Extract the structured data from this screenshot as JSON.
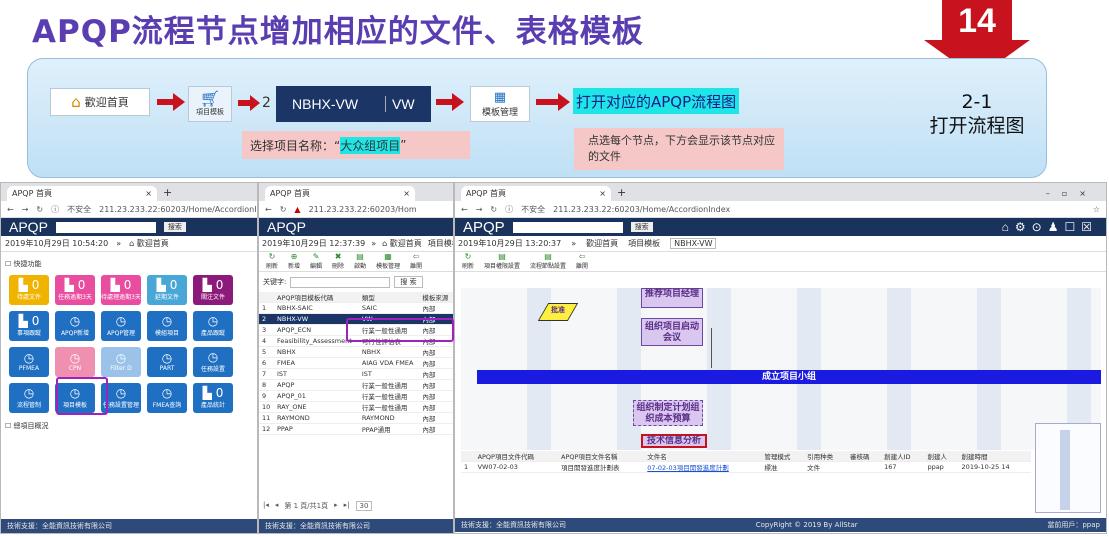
{
  "title": "APQP流程节点增加相应的文件、表格模板",
  "badge_number": "14",
  "banner": {
    "home_label": "歡迎首頁",
    "project_template_label": "項目模板",
    "row_num": "2",
    "row_code": "NBHX-VW",
    "row_type": "VW",
    "template_mgmt_label": "模板管理",
    "open_flow_text": "打开对应的APQP流程图",
    "select_text_prefix": "选择项目名称：“",
    "select_text_highlight": "大众组项目",
    "select_text_suffix": "”",
    "node_hint": "点选每个节点，下方会显示该节点对应的文件",
    "step_number": "2-1",
    "step_text": "打开流程图"
  },
  "win1": {
    "tab_title": "APQP 首頁",
    "url_prefix": "不安全",
    "url": "211.23.233.22:60203/Home/AccordionInd",
    "logo": "APQP",
    "search_btn": "搜索",
    "datetime": "2019年10月29日 10:54:20",
    "home_tab": "歡迎首頁",
    "section_quick": "快捷功能",
    "section_overview": "總項目概況",
    "tiles": [
      {
        "label": "待處文件",
        "count": "0",
        "color": "#f0b400"
      },
      {
        "label": "任務逾期3天",
        "count": "0",
        "color": "#e94da0"
      },
      {
        "label": "待處理逾期3天",
        "count": "0",
        "color": "#e94da0"
      },
      {
        "label": "延期文件",
        "count": "0",
        "color": "#49a7d8"
      },
      {
        "label": "關注文件",
        "count": "0",
        "color": "#8c1a7a"
      },
      {
        "label": "事項跟蹤",
        "count": "0",
        "color": "#1f6fc2"
      },
      {
        "label": "APQP新增",
        "count": "",
        "color": "#1f6fc2"
      },
      {
        "label": "APQP管理",
        "count": "",
        "color": "#1f6fc2"
      },
      {
        "label": "模組項目",
        "count": "",
        "color": "#1f6fc2"
      },
      {
        "label": "產品跟蹤",
        "count": "",
        "color": "#1f6fc2"
      },
      {
        "label": "PFMEA",
        "count": "",
        "color": "#1f6fc2"
      },
      {
        "label": "CPN",
        "count": "",
        "color": "#f090b0"
      },
      {
        "label": "Filter D",
        "count": "",
        "color": "#9bc3ea"
      },
      {
        "label": "PART",
        "count": "",
        "color": "#1f6fc2"
      },
      {
        "label": "任務設置",
        "count": "",
        "color": "#1f6fc2"
      },
      {
        "label": "流程管制",
        "count": "",
        "color": "#1f6fc2"
      },
      {
        "label": "項目模板",
        "count": "",
        "color": "#1f6fc2"
      },
      {
        "label": "任務設置管理",
        "count": "",
        "color": "#1f6fc2"
      },
      {
        "label": "FMEA查詢",
        "count": "",
        "color": "#1f6fc2"
      },
      {
        "label": "產品統計",
        "count": "0",
        "color": "#1f6fc2"
      }
    ],
    "footer": "技術支援：全能資訊技術有限公司"
  },
  "win2": {
    "tab_title": "APQP 首頁",
    "url": "211.23.233.22:60203/Hom",
    "datetime": "2019年10月29日 12:37:39",
    "home_tab": "歡迎首頁",
    "tab2": "項目模板",
    "toolbar": [
      "刷新",
      "新增",
      "編輯",
      "刪除",
      "啟動",
      "模板管理",
      "離開"
    ],
    "keyword_label": "关键字:",
    "search_btn": "搜 索",
    "columns": [
      "",
      "APQP項目模板代碼",
      "類型",
      "模板來源"
    ],
    "rows": [
      [
        "1",
        "NBHX-SAIC",
        "SAIC",
        "內部"
      ],
      [
        "2",
        "NBHX-VW",
        "VW",
        "內部"
      ],
      [
        "3",
        "APQP_ECN",
        "行業一般性通用",
        "內部"
      ],
      [
        "4",
        "Feasibility_Assessment",
        "可行性評估表",
        "內部"
      ],
      [
        "5",
        "NBHX",
        "NBHX",
        "內部"
      ],
      [
        "6",
        "FMEA",
        "AIAG VDA FMEA",
        "內部"
      ],
      [
        "7",
        "IST",
        "IST",
        "內部"
      ],
      [
        "8",
        "APQP",
        "行業一般性通用",
        "內部"
      ],
      [
        "9",
        "APQP_01",
        "行業一般性通用",
        "內部"
      ],
      [
        "10",
        "RAY_ONE",
        "行業一般性通用",
        "內部"
      ],
      [
        "11",
        "RAYMOND",
        "RAYMOND",
        "內部"
      ],
      [
        "12",
        "PPAP",
        "PPAP通用",
        "內部"
      ]
    ],
    "pager": "第  1  頁/共1頁",
    "page_size": "30",
    "footer": "技術支援：全能資訊技術有限公司"
  },
  "win3": {
    "tab_title": "APQP 首頁",
    "url": "211.23.233.22:60203/Home/AccordionIndex",
    "logo": "APQP",
    "search_btn": "搜索",
    "datetime": "2019年10月29日 13:20:37",
    "tabs": [
      "歡迎首頁",
      "項目模板",
      "NBHX-VW"
    ],
    "toolbar": [
      "刷新",
      "項目權限設置",
      "流程節點設置",
      "離開"
    ],
    "nodes": {
      "n1": "推荐项目经理",
      "diamond": "批准",
      "n2": "组织项目启动会议",
      "banner": "成立项目小组",
      "n3": "组织制定计划组织成本预算",
      "n4": "技术信息分析"
    },
    "columns": [
      "",
      "APQP項目文件代碼",
      "APQP項目文件名稱",
      "文件名",
      "管理模式",
      "引用种类",
      "審核碼",
      "創建人ID",
      "創建人",
      "創建時間"
    ],
    "rows": [
      [
        "1",
        "VW07-02-03",
        "項目開發進度計劃表",
        "07-02-03項目開發進度計劃",
        "標准",
        "文件",
        "",
        "167",
        "ppap",
        "2019-10-25 14"
      ]
    ],
    "footer_left": "技術支援：全能資訊技術有限公司",
    "footer_center": "CopyRight © 2019 By AllStar",
    "footer_right": "當前用戶：ppap"
  }
}
